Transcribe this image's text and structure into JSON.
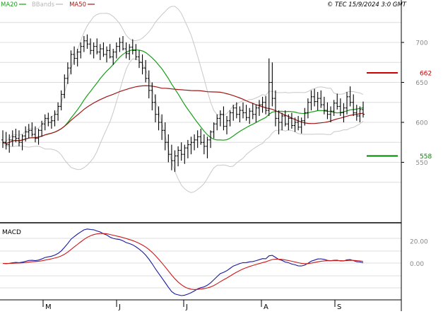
{
  "header": {
    "legend": [
      {
        "label": "MA20",
        "color": "#18a018"
      },
      {
        "label": "BBands",
        "color": "#b8b8b8"
      },
      {
        "label": "MA50",
        "color": "#a01818"
      }
    ],
    "copyright": "© TEC 15/9/2024 3:0 GMT"
  },
  "macd_panel": {
    "title": "MACD"
  },
  "colors": {
    "price_bars": "#000000",
    "ma20": "#18a018",
    "ma50": "#a01818",
    "bbands": "#c8c8c8",
    "resistance": "#cc0000",
    "support": "#008000",
    "macd": "#1a1aa0",
    "signal": "#cc1a1a",
    "grid": "#dcdcdc",
    "frame": "#000000"
  },
  "chart_data": [
    {
      "type": "ohlc",
      "name": "price",
      "y_ticks": [
        550,
        600,
        650,
        700
      ],
      "x_labels": [
        "M",
        "J",
        "J",
        "A",
        "S"
      ],
      "levels": [
        {
          "label": "662",
          "value": 662,
          "kind": "resistance"
        },
        {
          "label": "558",
          "value": 558,
          "kind": "support"
        }
      ],
      "bars": [
        [
          578,
          590,
          568,
          575
        ],
        [
          575,
          588,
          566,
          572
        ],
        [
          572,
          585,
          562,
          578
        ],
        [
          578,
          590,
          570,
          582
        ],
        [
          582,
          592,
          575,
          580
        ],
        [
          580,
          590,
          570,
          575
        ],
        [
          575,
          585,
          565,
          583
        ],
        [
          583,
          595,
          576,
          588
        ],
        [
          588,
          598,
          580,
          590
        ],
        [
          590,
          600,
          582,
          585
        ],
        [
          585,
          595,
          575,
          580
        ],
        [
          580,
          592,
          572,
          590
        ],
        [
          590,
          602,
          582,
          598
        ],
        [
          598,
          610,
          590,
          605
        ],
        [
          605,
          612,
          595,
          600
        ],
        [
          600,
          608,
          592,
          602
        ],
        [
          602,
          615,
          595,
          610
        ],
        [
          610,
          625,
          602,
          620
        ],
        [
          620,
          640,
          615,
          635
        ],
        [
          635,
          660,
          630,
          655
        ],
        [
          655,
          675,
          648,
          668
        ],
        [
          668,
          690,
          660,
          685
        ],
        [
          685,
          695,
          672,
          680
        ],
        [
          680,
          692,
          670,
          688
        ],
        [
          688,
          700,
          680,
          695
        ],
        [
          695,
          708,
          688,
          702
        ],
        [
          702,
          710,
          692,
          698
        ],
        [
          698,
          705,
          685,
          690
        ],
        [
          690,
          700,
          680,
          695
        ],
        [
          695,
          705,
          685,
          688
        ],
        [
          688,
          698,
          678,
          692
        ],
        [
          692,
          700,
          682,
          685
        ],
        [
          685,
          695,
          675,
          690
        ],
        [
          690,
          698,
          680,
          682
        ],
        [
          682,
          692,
          672,
          688
        ],
        [
          688,
          700,
          680,
          695
        ],
        [
          695,
          706,
          688,
          700
        ],
        [
          700,
          708,
          690,
          692
        ],
        [
          692,
          700,
          680,
          686
        ],
        [
          686,
          698,
          678,
          694
        ],
        [
          694,
          704,
          685,
          690
        ],
        [
          690,
          698,
          678,
          682
        ],
        [
          682,
          690,
          668,
          675
        ],
        [
          675,
          685,
          660,
          668
        ],
        [
          668,
          678,
          650,
          655
        ],
        [
          655,
          665,
          630,
          640
        ],
        [
          640,
          650,
          615,
          625
        ],
        [
          625,
          635,
          600,
          610
        ],
        [
          610,
          620,
          590,
          600
        ],
        [
          600,
          610,
          578,
          590
        ],
        [
          590,
          600,
          565,
          575
        ],
        [
          575,
          585,
          550,
          560
        ],
        [
          560,
          572,
          540,
          552
        ],
        [
          552,
          565,
          538,
          558
        ],
        [
          558,
          570,
          545,
          565
        ],
        [
          565,
          575,
          552,
          560
        ],
        [
          560,
          572,
          548,
          568
        ],
        [
          568,
          578,
          555,
          572
        ],
        [
          572,
          582,
          560,
          575
        ],
        [
          575,
          585,
          565,
          578
        ],
        [
          578,
          590,
          568,
          582
        ],
        [
          582,
          592,
          572,
          575
        ],
        [
          575,
          585,
          560,
          570
        ],
        [
          570,
          582,
          555,
          578
        ],
        [
          578,
          590,
          568,
          588
        ],
        [
          588,
          600,
          580,
          598
        ],
        [
          598,
          610,
          590,
          605
        ],
        [
          605,
          615,
          595,
          610
        ],
        [
          610,
          620,
          590,
          595
        ],
        [
          595,
          608,
          585,
          602
        ],
        [
          602,
          615,
          595,
          612
        ],
        [
          612,
          622,
          602,
          618
        ],
        [
          618,
          625,
          605,
          610
        ],
        [
          610,
          620,
          600,
          615
        ],
        [
          615,
          625,
          605,
          612
        ],
        [
          612,
          622,
          602,
          606
        ],
        [
          606,
          618,
          598,
          614
        ],
        [
          614,
          624,
          604,
          610
        ],
        [
          610,
          622,
          600,
          618
        ],
        [
          618,
          628,
          608,
          622
        ],
        [
          622,
          632,
          612,
          625
        ],
        [
          625,
          633,
          610,
          615
        ],
        [
          615,
          680,
          608,
          650
        ],
        [
          650,
          675,
          620,
          630
        ],
        [
          630,
          640,
          595,
          605
        ],
        [
          605,
          615,
          585,
          600
        ],
        [
          600,
          612,
          590,
          608
        ],
        [
          608,
          615,
          595,
          598
        ],
        [
          598,
          610,
          590,
          605
        ],
        [
          605,
          612,
          592,
          596
        ],
        [
          596,
          606,
          588,
          600
        ],
        [
          600,
          608,
          590,
          594
        ],
        [
          594,
          606,
          586,
          602
        ],
        [
          602,
          618,
          596,
          612
        ],
        [
          612,
          630,
          605,
          625
        ],
        [
          625,
          640,
          615,
          632
        ],
        [
          632,
          642,
          620,
          626
        ],
        [
          626,
          638,
          615,
          630
        ],
        [
          630,
          640,
          618,
          622
        ],
        [
          622,
          632,
          610,
          615
        ],
        [
          615,
          625,
          604,
          610
        ],
        [
          610,
          620,
          600,
          614
        ],
        [
          614,
          628,
          608,
          624
        ],
        [
          624,
          636,
          616,
          620
        ],
        [
          620,
          630,
          608,
          612
        ],
        [
          612,
          624,
          600,
          618
        ],
        [
          618,
          638,
          610,
          632
        ],
        [
          632,
          645,
          620,
          625
        ],
        [
          625,
          635,
          608,
          612
        ],
        [
          612,
          622,
          602,
          608
        ],
        [
          608,
          620,
          600,
          616
        ],
        [
          616,
          626,
          606,
          610
        ]
      ]
    },
    {
      "type": "line",
      "name": "macd",
      "y_ticks": [
        0,
        20
      ],
      "y_range": [
        -30,
        35
      ]
    }
  ]
}
